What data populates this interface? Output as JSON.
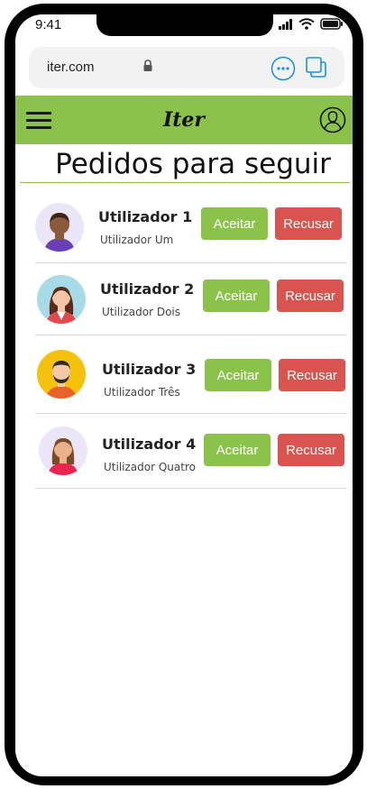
{
  "status_bar": {
    "time": "9:41"
  },
  "browser": {
    "url": "iter.com"
  },
  "header": {
    "brand": "Iter"
  },
  "page": {
    "title": "Pedidos para seguir"
  },
  "actions": {
    "accept_label": "Aceitar",
    "refuse_label": "Recusar"
  },
  "requests": [
    {
      "name": "Utilizador 1",
      "subtitle": "Utilizador Um"
    },
    {
      "name": "Utilizador 2",
      "subtitle": "Utilizador Dois"
    },
    {
      "name": "Utilizador 3",
      "subtitle": "Utilizador Três"
    },
    {
      "name": "Utilizador 4",
      "subtitle": "Utilizador Quatro"
    }
  ],
  "colors": {
    "brand_green": "#8bc34a",
    "refuse_red": "#d9534f"
  }
}
